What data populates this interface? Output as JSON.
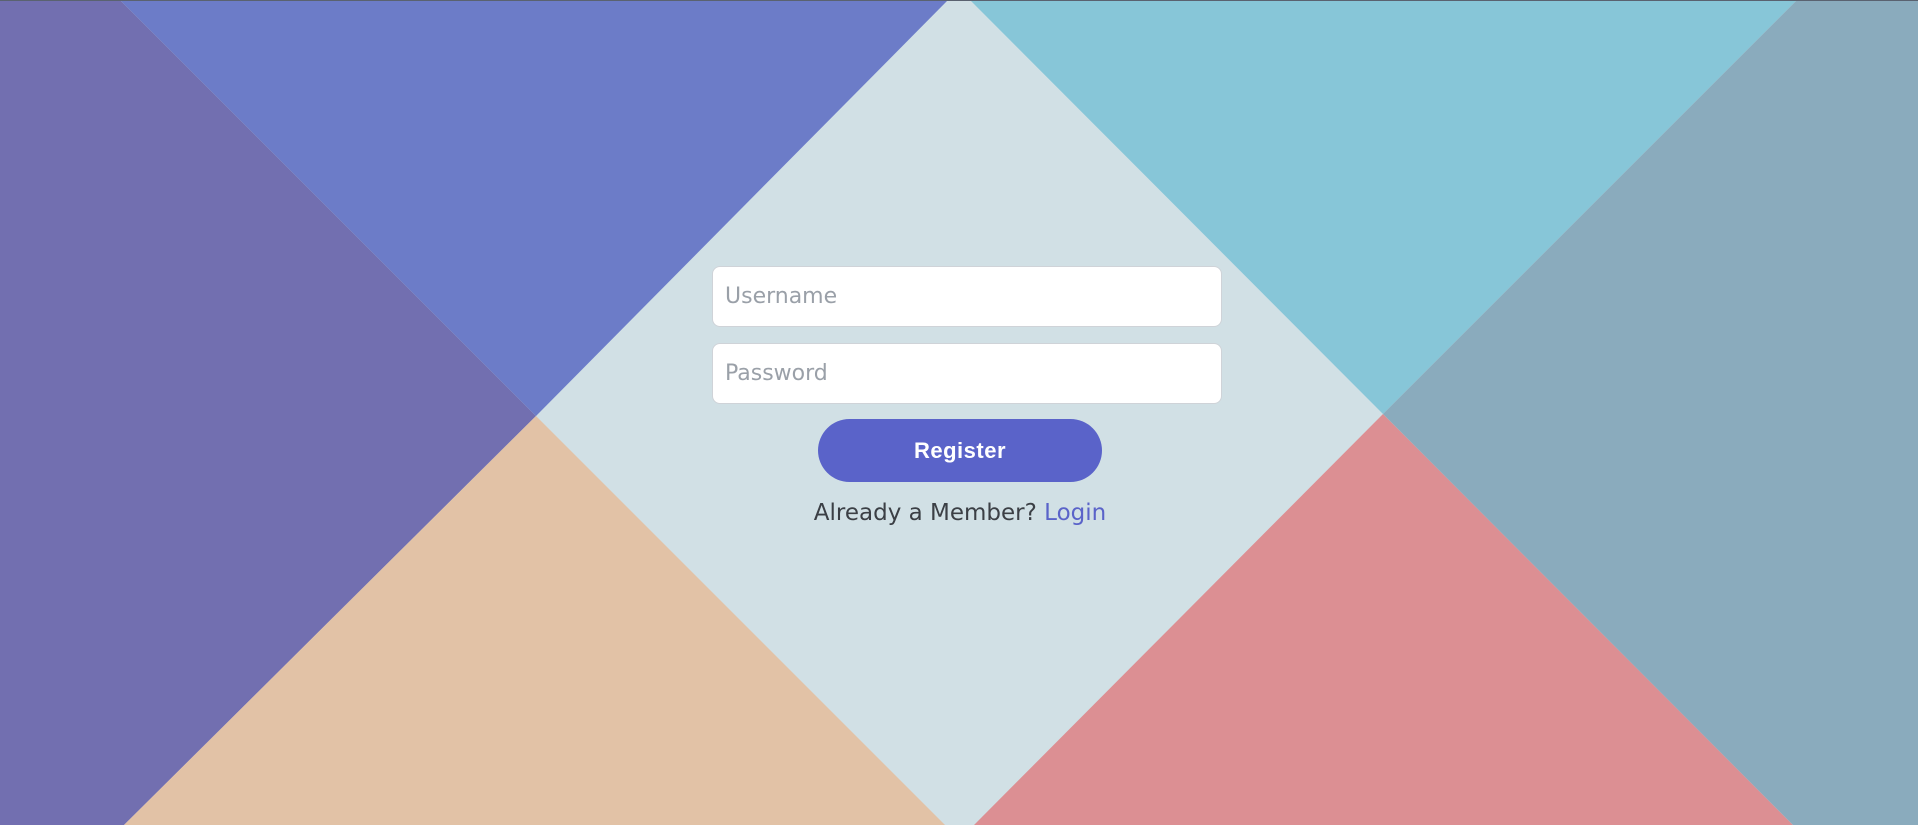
{
  "background": {
    "colors": {
      "left": "#726fb0",
      "top_left": "#6c7cc8",
      "center": "#d1e0e5",
      "top_right": "#87c6d8",
      "right": "#8aabbd",
      "bottom_left": "#e2c2a6",
      "bottom_right": "#dc8f93"
    }
  },
  "form": {
    "username": {
      "placeholder": "Username",
      "value": ""
    },
    "password": {
      "placeholder": "Password",
      "value": ""
    },
    "register_label": "Register",
    "member_text": "Already a Member?",
    "login_label": "Login"
  },
  "colors": {
    "accent": "#5a63c9",
    "text": "#3b3f45"
  }
}
